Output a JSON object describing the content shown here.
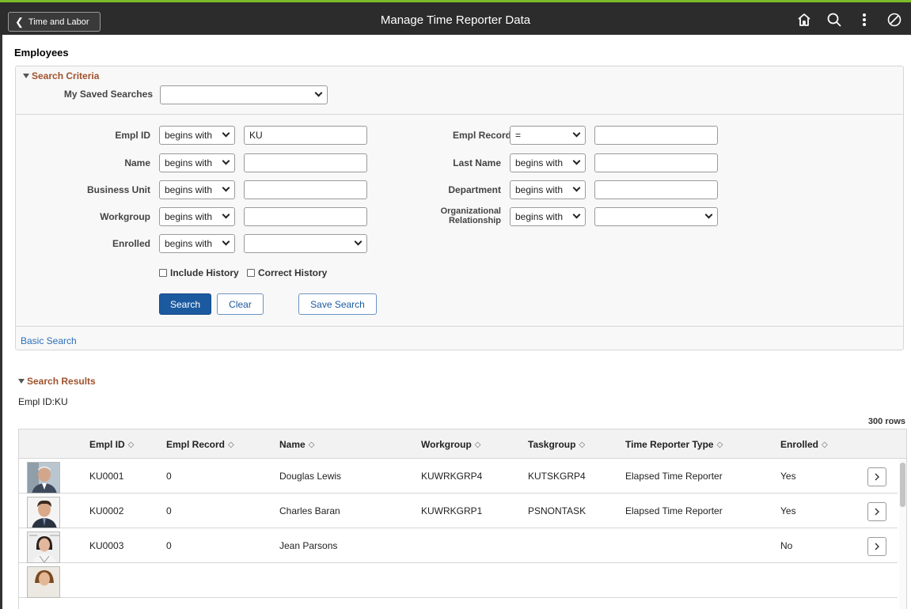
{
  "banner": {
    "back_label": "Time and Labor",
    "title": "Manage Time Reporter Data",
    "icons": [
      "home-icon",
      "search-icon",
      "actions-menu-icon",
      "navbar-icon"
    ],
    "accent_color": "#7cbb2a"
  },
  "page": {
    "title": "Employees"
  },
  "criteria": {
    "header": "Search Criteria",
    "saved_searches_label": "My Saved Searches",
    "saved_searches_value": "",
    "fields": {
      "empl_id": {
        "label": "Empl ID",
        "operator": "begins with",
        "value": "KU"
      },
      "name": {
        "label": "Name",
        "operator": "begins with",
        "value": ""
      },
      "business_unit": {
        "label": "Business Unit",
        "operator": "begins with",
        "value": ""
      },
      "workgroup": {
        "label": "Workgroup",
        "operator": "begins with",
        "value": ""
      },
      "enrolled": {
        "label": "Enrolled",
        "operator": "begins with",
        "value": ""
      },
      "empl_record": {
        "label": "Empl Record",
        "operator": "=",
        "value": ""
      },
      "last_name": {
        "label": "Last Name",
        "operator": "begins with",
        "value": ""
      },
      "department": {
        "label": "Department",
        "operator": "begins with",
        "value": ""
      },
      "org_relationship": {
        "label_line1": "Organizational",
        "label_line2": "Relationship",
        "operator": "begins with",
        "value": ""
      }
    },
    "include_history": "Include History",
    "correct_history": "Correct History",
    "search_button": "Search",
    "clear_button": "Clear",
    "save_search_button": "Save Search",
    "basic_search_link": "Basic Search"
  },
  "results": {
    "header": "Search Results",
    "subtitle": "Empl ID:KU",
    "row_count": "300 rows",
    "columns": [
      "Empl ID",
      "Empl Record",
      "Name",
      "Workgroup",
      "Taskgroup",
      "Time Reporter Type",
      "Enrolled"
    ],
    "rows": [
      {
        "empl_id": "KU0001",
        "empl_record": "0",
        "name": "Douglas Lewis",
        "workgroup": "KUWRKGRP4",
        "taskgroup": "KUTSKGRP4",
        "reporter_type": "Elapsed Time Reporter",
        "enrolled": "Yes"
      },
      {
        "empl_id": "KU0002",
        "empl_record": "0",
        "name": "Charles Baran",
        "workgroup": "KUWRKGRP1",
        "taskgroup": "PSNONTASK",
        "reporter_type": "Elapsed Time Reporter",
        "enrolled": "Yes"
      },
      {
        "empl_id": "KU0003",
        "empl_record": "0",
        "name": "Jean Parsons",
        "workgroup": "",
        "taskgroup": "",
        "reporter_type": "",
        "enrolled": "No"
      }
    ]
  }
}
